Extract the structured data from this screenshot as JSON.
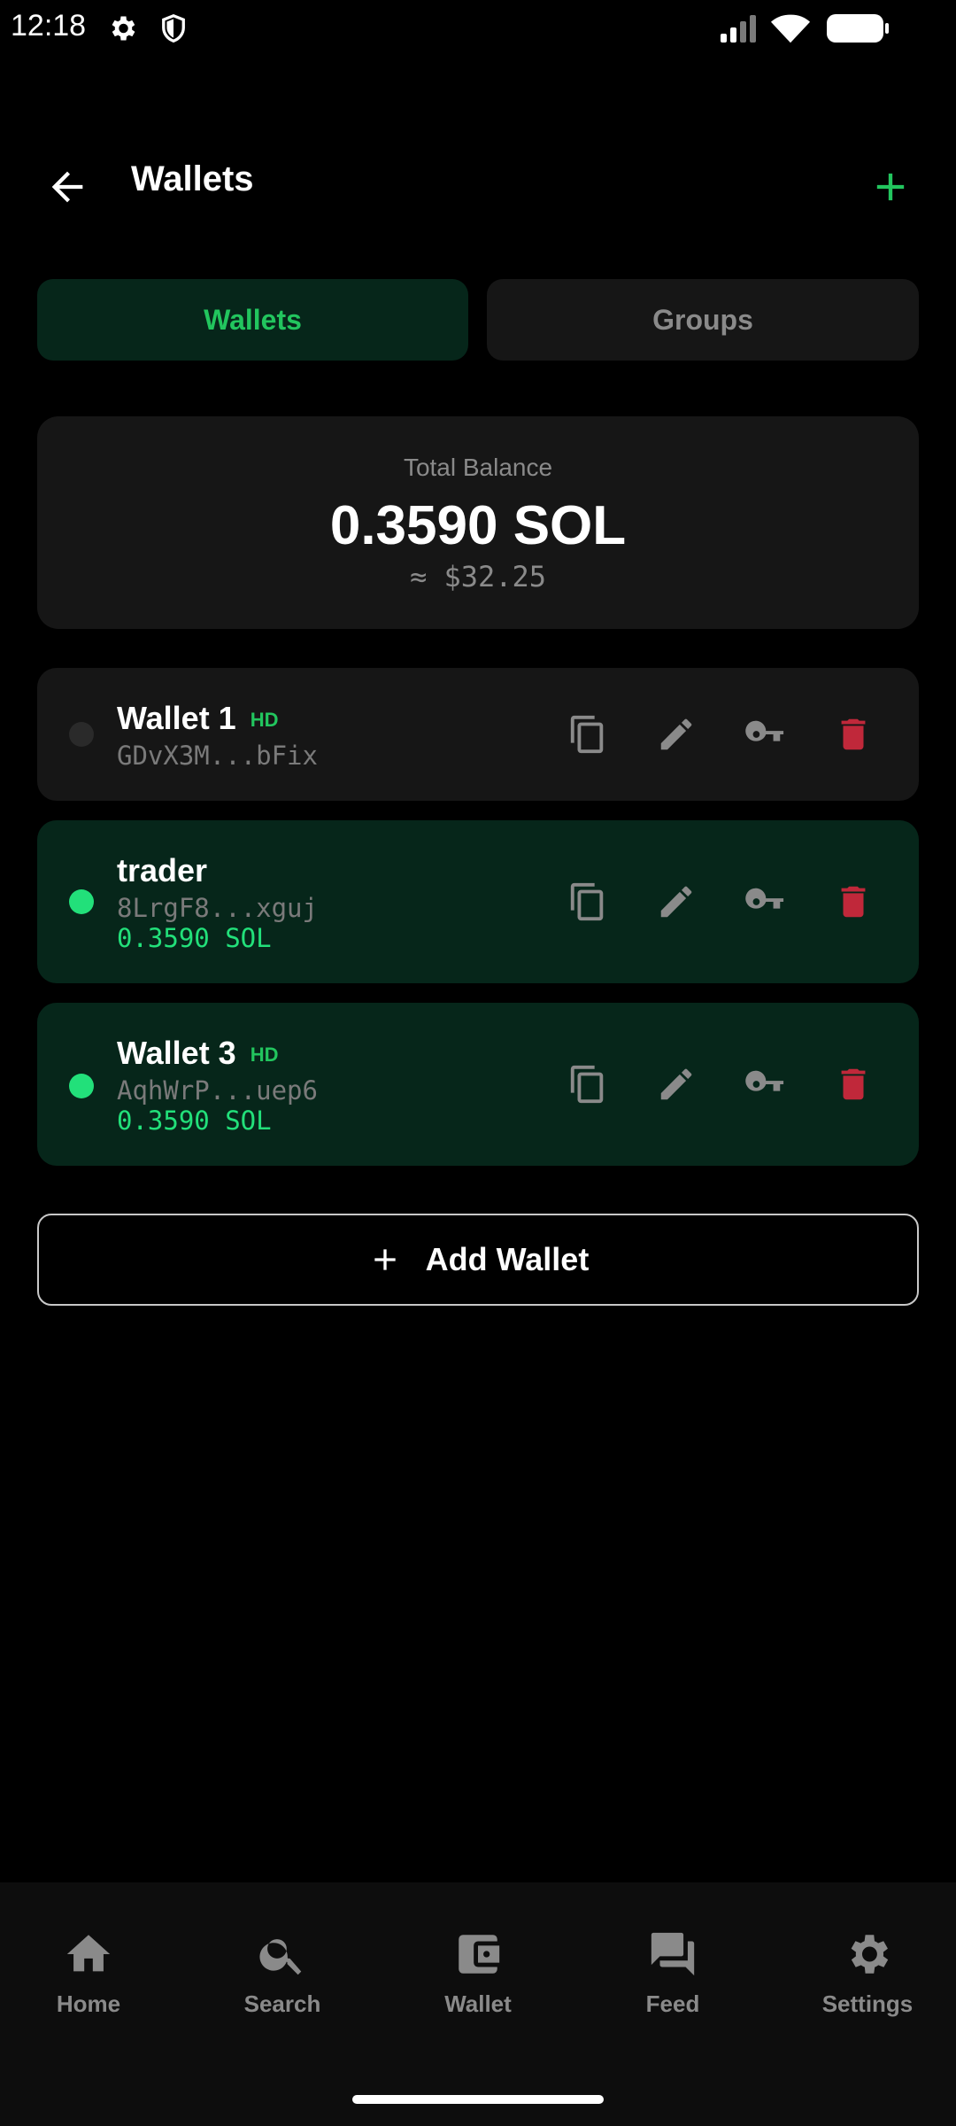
{
  "status_bar": {
    "time": "12:18"
  },
  "header": {
    "title": "Wallets"
  },
  "tabs": [
    {
      "label": "Wallets",
      "active": true
    },
    {
      "label": "Groups",
      "active": false
    }
  ],
  "balance": {
    "label": "Total Balance",
    "amount": "0.3590 SOL",
    "fiat": "≈ $32.25"
  },
  "wallets": [
    {
      "name": "Wallet 1",
      "badge": "HD",
      "address": "GDvX3M...bFix",
      "balance": "",
      "active": false
    },
    {
      "name": "trader",
      "badge": "",
      "address": "8LrgF8...xguj",
      "balance": "0.3590 SOL",
      "active": true
    },
    {
      "name": "Wallet 3",
      "badge": "HD",
      "address": "AqhWrP...uep6",
      "balance": "0.3590 SOL",
      "active": true
    }
  ],
  "add_wallet": {
    "label": "Add Wallet"
  },
  "nav": [
    {
      "label": "Home",
      "icon": "home-icon"
    },
    {
      "label": "Search",
      "icon": "search-icon"
    },
    {
      "label": "Wallet",
      "icon": "wallet-icon"
    },
    {
      "label": "Feed",
      "icon": "chat-icon"
    },
    {
      "label": "Settings",
      "icon": "gear-icon"
    }
  ],
  "colors": {
    "accent": "#22c55e",
    "active_dot": "#22e07a",
    "active_card": "#06261a",
    "card": "#161616",
    "delete": "#c0283a"
  }
}
